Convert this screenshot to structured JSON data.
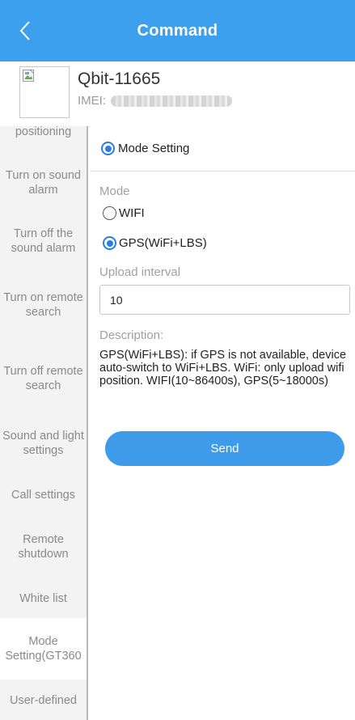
{
  "header": {
    "title": "Command"
  },
  "device": {
    "name": "Qbit-11665",
    "imei_label": "IMEI:"
  },
  "sidebar": {
    "items": [
      {
        "label": "positioning"
      },
      {
        "label": "Turn on sound alarm"
      },
      {
        "label": "Turn off the sound alarm"
      },
      {
        "label": "Turn on remote search"
      },
      {
        "label": "Turn off remote search"
      },
      {
        "label": "Sound and light settings"
      },
      {
        "label": "Call settings"
      },
      {
        "label": "Remote shutdown"
      },
      {
        "label": "White list"
      },
      {
        "label": "Mode Setting(GT360"
      },
      {
        "label": "User-defined"
      }
    ]
  },
  "form": {
    "section_title": "Mode Setting",
    "mode_label": "Mode",
    "options": [
      {
        "label": "WIFI",
        "selected": false
      },
      {
        "label": "GPS(WiFi+LBS)",
        "selected": true
      }
    ],
    "interval_label": "Upload interval",
    "interval_value": "10",
    "description_label": "Description:",
    "description_text": "GPS(WiFi+LBS): if GPS is not available, device auto-switch to WiFi+LBS. WiFi: only upload wifi position. WIFI(10~86400s), GPS(5~18000s)",
    "send_label": "Send"
  },
  "colors": {
    "header_bg": "#3da0ef",
    "accent": "#2a7ee0",
    "send_button": "#3d9be9",
    "sidebar_bg": "#f3f3f3"
  },
  "icons": {
    "back": "chevron-left-icon",
    "avatar": "broken-image-icon"
  }
}
